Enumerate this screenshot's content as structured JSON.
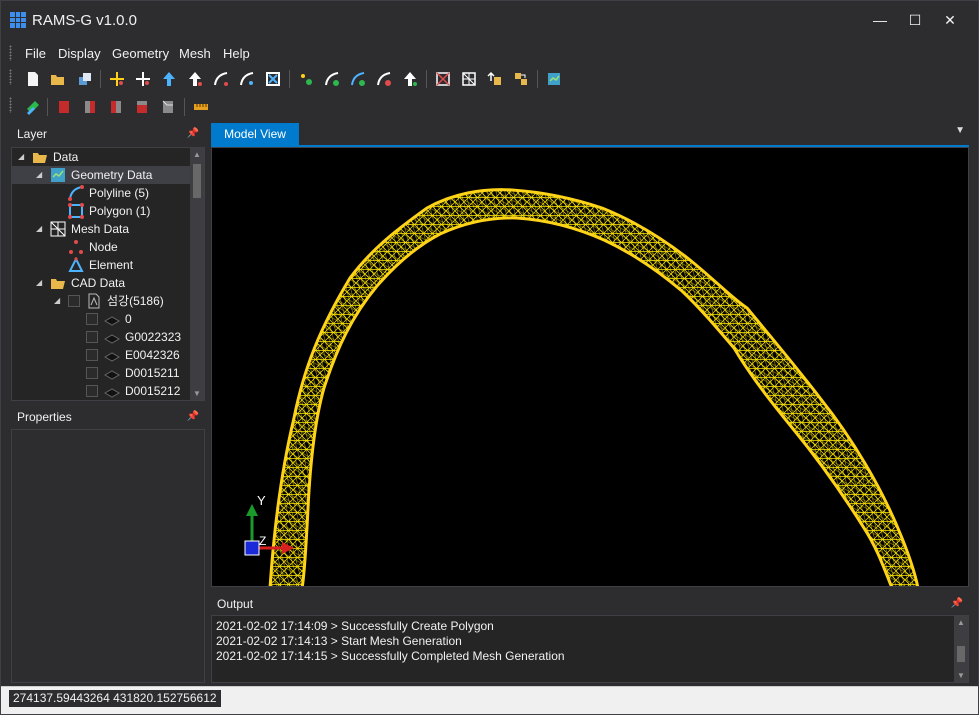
{
  "window": {
    "title": "RAMS-G v1.0.0",
    "minimize": "—",
    "maximize": "☐",
    "close": "✕"
  },
  "menu": {
    "items": [
      "File",
      "Display",
      "Geometry",
      "Mesh",
      "Help"
    ]
  },
  "layer_panel": {
    "title": "Layer",
    "tree": {
      "data": "Data",
      "geometry_data": "Geometry Data",
      "polyline": "Polyline (5)",
      "polygon": "Polygon (1)",
      "mesh_data": "Mesh Data",
      "node": "Node",
      "element": "Element",
      "cad_data": "CAD Data",
      "cad_file": "섬강(5186)",
      "layers": [
        "0",
        "G0022323",
        "E0042326",
        "D0015211",
        "D0015212"
      ]
    }
  },
  "properties_panel": {
    "title": "Properties"
  },
  "model_view": {
    "tab_label": "Model View",
    "axis_y": "Y",
    "axis_z": "Z"
  },
  "output_panel": {
    "title": "Output",
    "lines": [
      "2021-02-02 17:14:09 > Successfully Create Polygon",
      "2021-02-02 17:14:13 > Start Mesh Generation",
      "2021-02-02 17:14:15 > Successfully Completed Mesh Generation"
    ]
  },
  "status": {
    "coordinates": "274137.59443264 431820.152756612"
  },
  "colors": {
    "accent": "#007acc",
    "mesh": "#ffe800",
    "boundary": "#ffd21a",
    "background": "#2d2d30"
  }
}
